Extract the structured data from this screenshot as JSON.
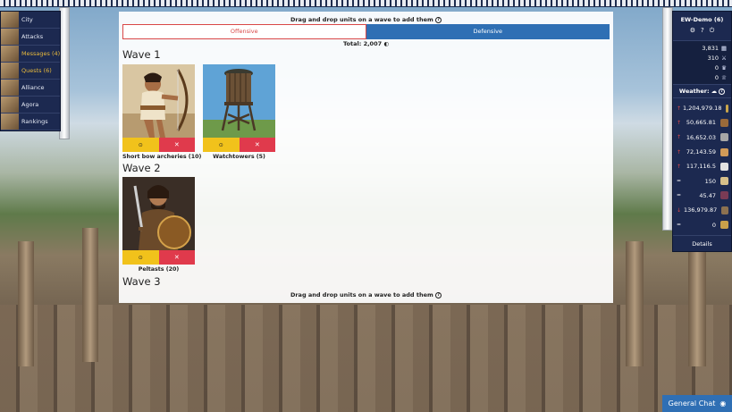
{
  "left_menu": [
    {
      "label": "City",
      "highlight": false
    },
    {
      "label": "Attacks",
      "highlight": false
    },
    {
      "label": "Messages (4)",
      "highlight": true
    },
    {
      "label": "Quests (6)",
      "highlight": true
    },
    {
      "label": "Alliance",
      "highlight": false
    },
    {
      "label": "Agora",
      "highlight": false
    },
    {
      "label": "Rankings",
      "highlight": false
    }
  ],
  "right_panel": {
    "city_name": "EW-Demo (6)",
    "stats": [
      {
        "value": "3,831",
        "icon": "grid-icon"
      },
      {
        "value": "310",
        "icon": "sword-icon"
      },
      {
        "value": "0",
        "icon": "crown-icon"
      },
      {
        "value": "0",
        "icon": "trophy-icon"
      }
    ],
    "weather_label": "Weather:",
    "resources": [
      {
        "sign": "↑",
        "value": "1,204,979.18",
        "icon": "gold-coins-icon",
        "color": "#caa64a"
      },
      {
        "sign": "↑",
        "value": "50,665.81",
        "icon": "wood-icon",
        "color": "#9a6a3a"
      },
      {
        "sign": "↑",
        "value": "16,652.03",
        "icon": "stone-icon",
        "color": "#a7a7a7"
      },
      {
        "sign": "↑",
        "value": "72,143.59",
        "icon": "bread-icon",
        "color": "#d19a58"
      },
      {
        "sign": "↑",
        "value": "117,116.5",
        "icon": "marble-icon",
        "color": "#e2e2e2"
      },
      {
        "sign": "=",
        "value": "150",
        "icon": "scroll-icon",
        "color": "#d7c08a"
      },
      {
        "sign": "=",
        "value": "45.47",
        "icon": "wine-icon",
        "color": "#7a3b55"
      },
      {
        "sign": "↓",
        "value": "136,979.87",
        "icon": "cart-icon",
        "color": "#8c7150"
      },
      {
        "sign": "=",
        "value": "0",
        "icon": "hoplite-icon",
        "color": "#c9a04a"
      }
    ],
    "details_label": "Details"
  },
  "modal": {
    "instruction": "Drag and drop units on a wave to add them",
    "tab_offensive": "Offensive",
    "tab_defensive": "Defensive",
    "total_label": "Total:",
    "total_value": "2,007",
    "waves": [
      {
        "title": "Wave 1",
        "units": [
          {
            "label": "Short bow archeries (10)"
          },
          {
            "label": "Watchtowers (5)"
          }
        ]
      },
      {
        "title": "Wave 2",
        "units": [
          {
            "label": "Peltasts (20)"
          }
        ]
      },
      {
        "title": "Wave 3",
        "units": []
      }
    ],
    "instruction_bottom": "Drag and drop units on a wave to add them"
  },
  "chat_label": "General Chat",
  "colors": {
    "offensive": "#d94747",
    "defensive": "#2f6fb4",
    "info_button": "#f1c21b",
    "delete_button": "#e03a4c"
  }
}
